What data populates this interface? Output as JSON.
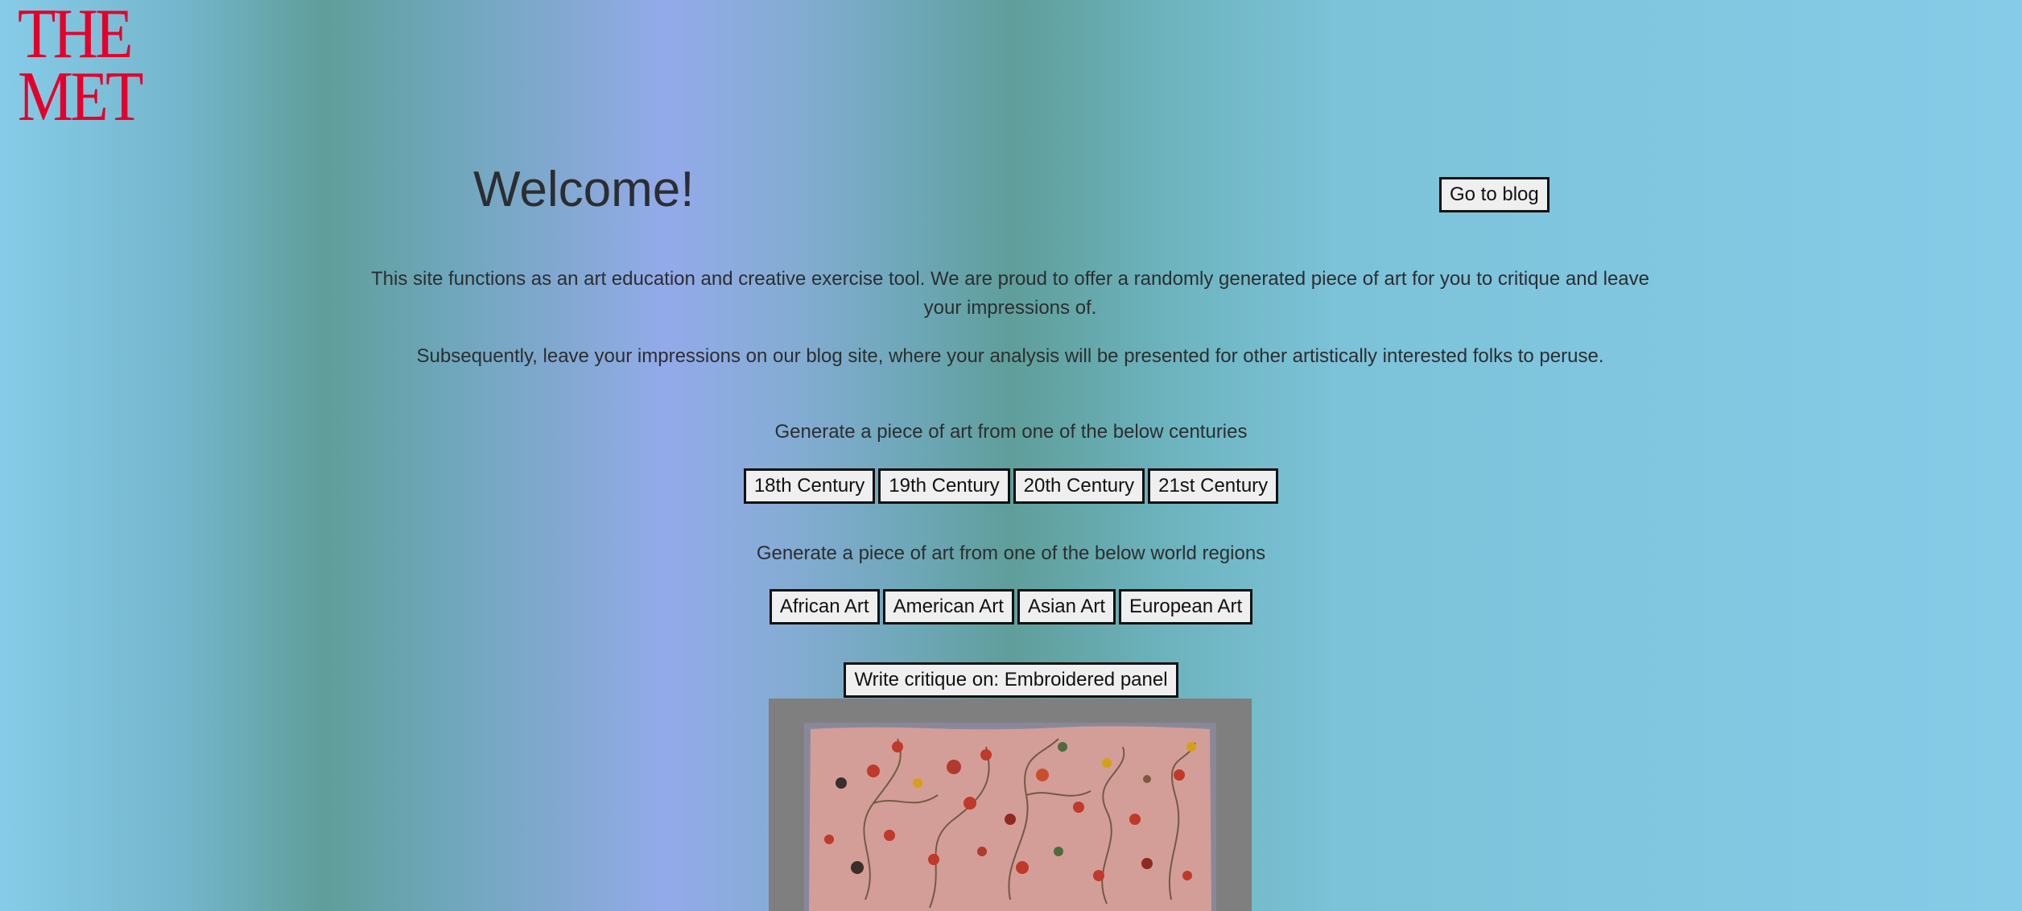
{
  "logo": {
    "line1": "THE",
    "line2": "MET"
  },
  "header": {
    "title": "Welcome!",
    "blog_button": "Go to blog"
  },
  "intro": {
    "paragraph1": "This site functions as an art education and creative exercise tool. We are proud to offer a randomly generated piece of art for you to critique and leave your impressions of.",
    "paragraph2": "Subsequently, leave your impressions on our blog site, where your analysis will be presented for other artistically interested folks to peruse."
  },
  "centuries": {
    "label": "Generate a piece of art from one of the below centuries",
    "buttons": [
      "18th Century",
      "19th Century",
      "20th Century",
      "21st Century"
    ]
  },
  "regions": {
    "label": "Generate a piece of art from one of the below world regions",
    "buttons": [
      "African Art",
      "American Art",
      "Asian Art",
      "European Art"
    ]
  },
  "critique": {
    "button": "Write critique on: Embroidered panel"
  },
  "colors": {
    "logo_red": "#e4002b",
    "art_mat": "#7f7f7f",
    "fabric": "#d39e98"
  }
}
